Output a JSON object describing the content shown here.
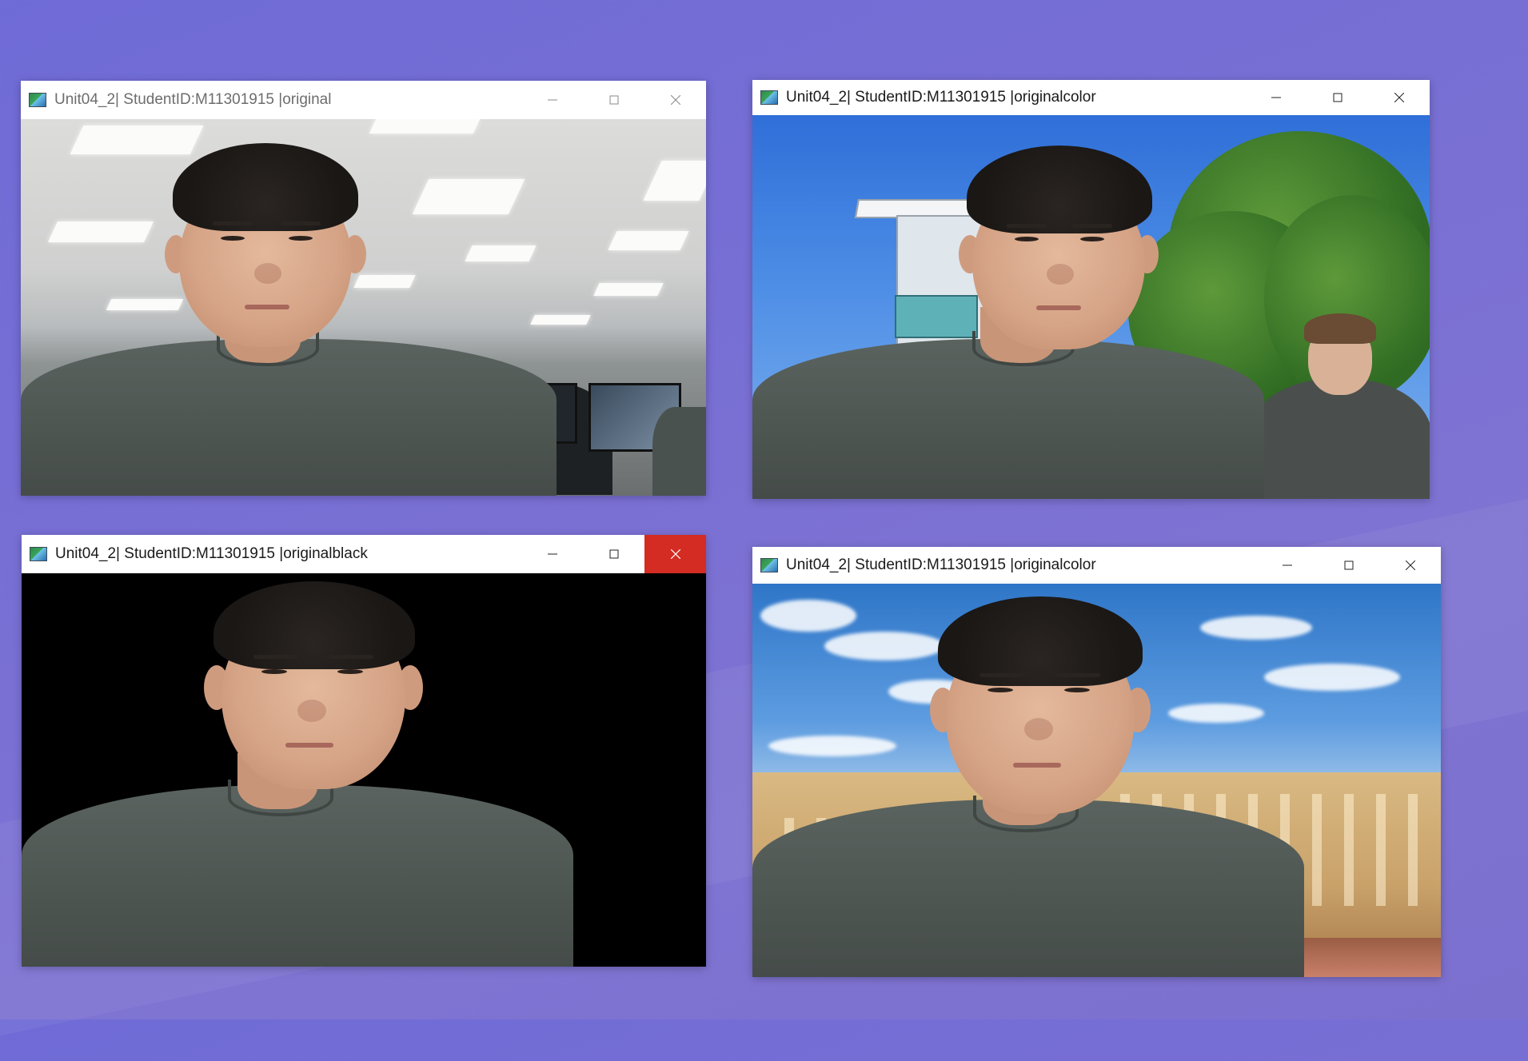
{
  "desktop": {
    "background_color": "#7a70d4"
  },
  "windows": [
    {
      "title": "Unit04_2| StudentID:M11301915 |original",
      "state": "inactive",
      "scene": "office webcam frame"
    },
    {
      "title": "Unit04_2| StudentID:M11301915 |originalcolor",
      "state": "active",
      "scene": "person over building and tree background"
    },
    {
      "title": "Unit04_2| StudentID:M11301915 |originalblack",
      "state": "active",
      "close_hovered": true,
      "scene": "person over black background"
    },
    {
      "title": "Unit04_2| StudentID:M11301915 |originalcolor",
      "state": "active",
      "scene": "person over palace background"
    }
  ],
  "controls": {
    "minimize_icon": "minimize-icon",
    "maximize_icon": "maximize-icon",
    "close_icon": "close-icon"
  },
  "colors": {
    "close_hover": "#d42b22",
    "titlebar": "#ffffff"
  }
}
